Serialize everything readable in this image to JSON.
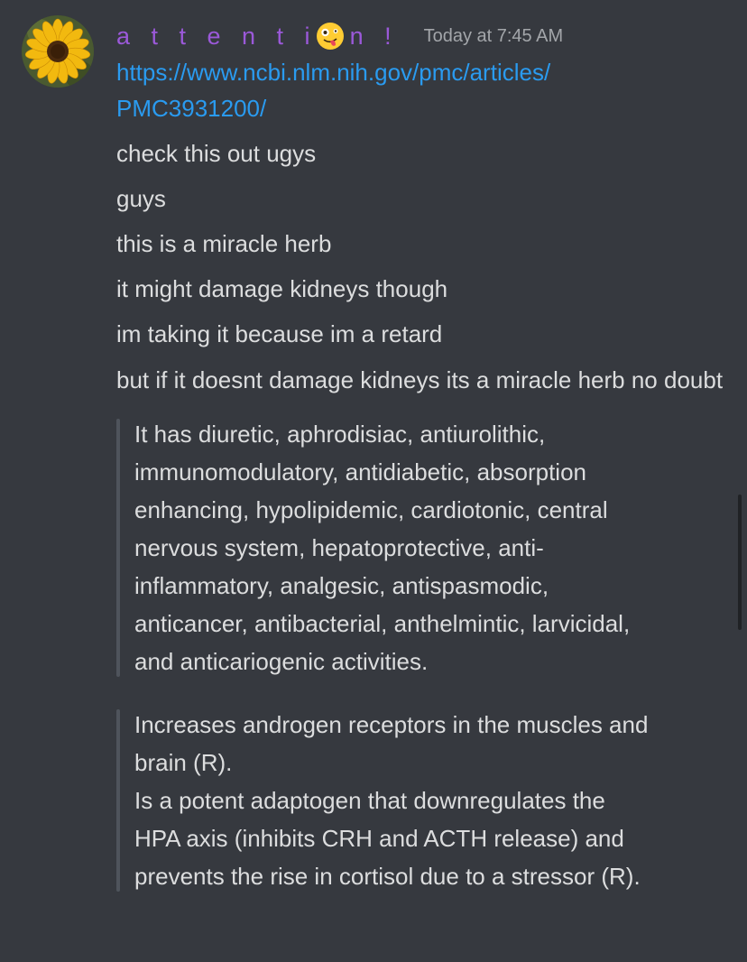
{
  "message": {
    "author": {
      "name_part1": "a t t e n t i",
      "emoji": "zany-face-emoji",
      "name_part2": "n !",
      "color": "#9b59d9"
    },
    "timestamp": "Today at 7:45 AM",
    "link_line1": "https://www.ncbi.nlm.nih.gov/pmc/articles/",
    "link_line2": "PMC3931200/",
    "lines": [
      "check this out ugys",
      "guys",
      "this is a miracle herb",
      "it might damage kidneys though",
      "im taking it because im a retard",
      "but if it doesnt damage kidneys its a miracle herb no doubt"
    ],
    "quote1": [
      "It has diuretic, aphrodisiac, antiurolithic,",
      "immunomodulatory, antidiabetic, absorption",
      "enhancing, hypolipidemic, cardiotonic, central",
      "nervous system, hepatoprotective, anti-",
      "inflammatory, analgesic, antispasmodic,",
      "anticancer, antibacterial, anthelmintic, larvicidal,",
      "and anticariogenic activities."
    ],
    "quote2": [
      "Increases androgen receptors in the muscles and",
      "brain (R).",
      "Is a potent adaptogen that downregulates the",
      "HPA axis (inhibits CRH and ACTH release) and",
      "prevents the rise in cortisol due to a stressor (R)."
    ]
  },
  "colors": {
    "background": "#36393f",
    "text": "#dcddde",
    "link": "#2a9bf0",
    "timestamp": "#a3a6aa",
    "quote_bar": "#4f545c"
  }
}
